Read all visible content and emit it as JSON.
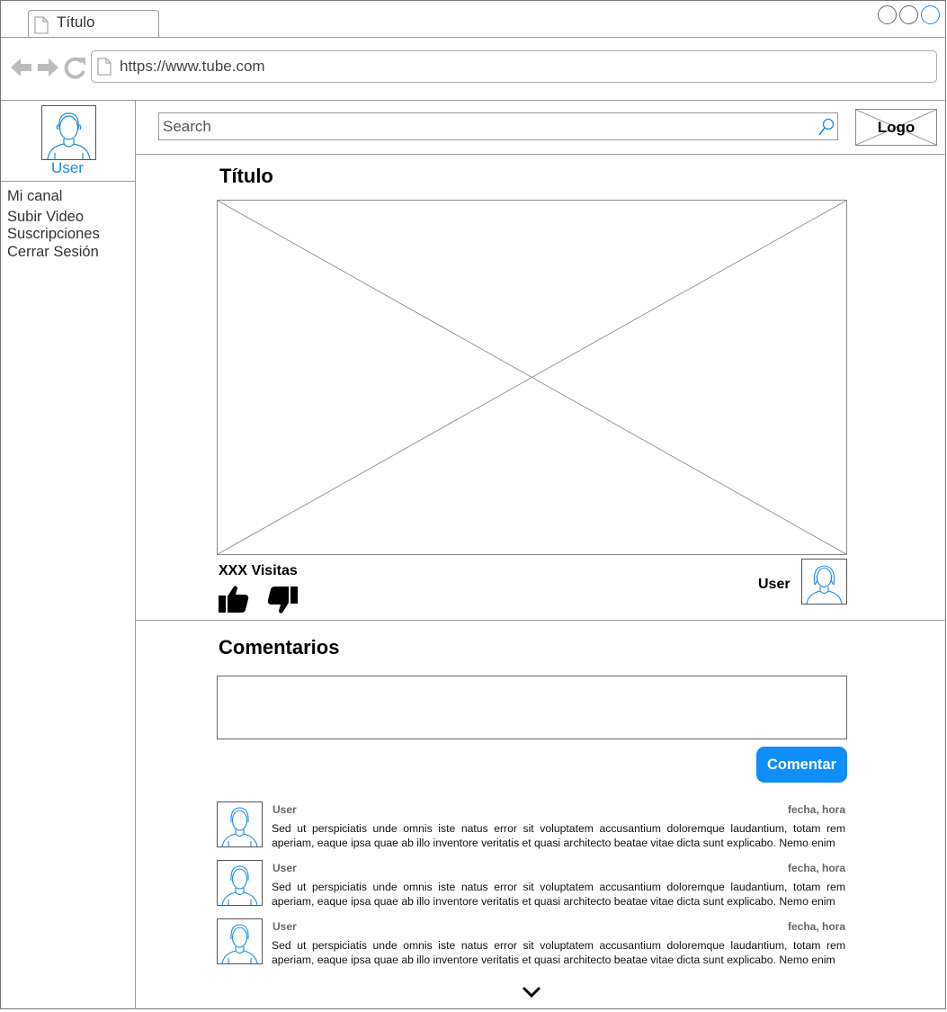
{
  "browser": {
    "tab_title": "Título",
    "url": "https://www.tube.com"
  },
  "sidebar": {
    "user_label": "User",
    "items": [
      {
        "label": "Mi canal"
      },
      {
        "label": "Subir Video"
      },
      {
        "label": "Suscripciones"
      },
      {
        "label": "Cerrar Sesión"
      }
    ]
  },
  "header": {
    "search_placeholder": "Search",
    "logo_label": "Logo"
  },
  "video": {
    "title": "Título",
    "views": "XXX Visitas",
    "uploader": "User"
  },
  "comments": {
    "title": "Comentarios",
    "submit_label": "Comentar",
    "items": [
      {
        "user": "User",
        "date": "fecha, hora",
        "text": "Sed ut perspiciatis unde omnis iste natus error sit voluptatem accusantium doloremque laudantium, totam rem aperiam, eaque ipsa quae ab illo inventore veritatis et quasi architecto beatae vitae dicta sunt explicabo. Nemo enim"
      },
      {
        "user": "User",
        "date": "fecha, hora",
        "text": "Sed ut perspiciatis unde omnis iste natus error sit voluptatem accusantium doloremque laudantium, totam rem aperiam, eaque ipsa quae ab illo inventore veritatis et quasi architecto beatae vitae dicta sunt explicabo. Nemo enim"
      },
      {
        "user": "User",
        "date": "fecha, hora",
        "text": "Sed ut perspiciatis unde omnis iste natus error sit voluptatem accusantium doloremque laudantium, totam rem aperiam, eaque ipsa quae ab illo inventore veritatis et quasi architecto beatae vitae dicta sunt explicabo. Nemo enim"
      }
    ]
  },
  "icons": {
    "back": "arrow-left-icon",
    "forward": "arrow-right-icon",
    "reload": "reload-icon",
    "search": "search-icon",
    "like": "thumbs-up-icon",
    "dislike": "thumbs-down-icon",
    "more": "chevron-down-icon"
  },
  "colors": {
    "accent": "#1b8be0",
    "button": "#0f8ef9",
    "wire": "#999999"
  }
}
